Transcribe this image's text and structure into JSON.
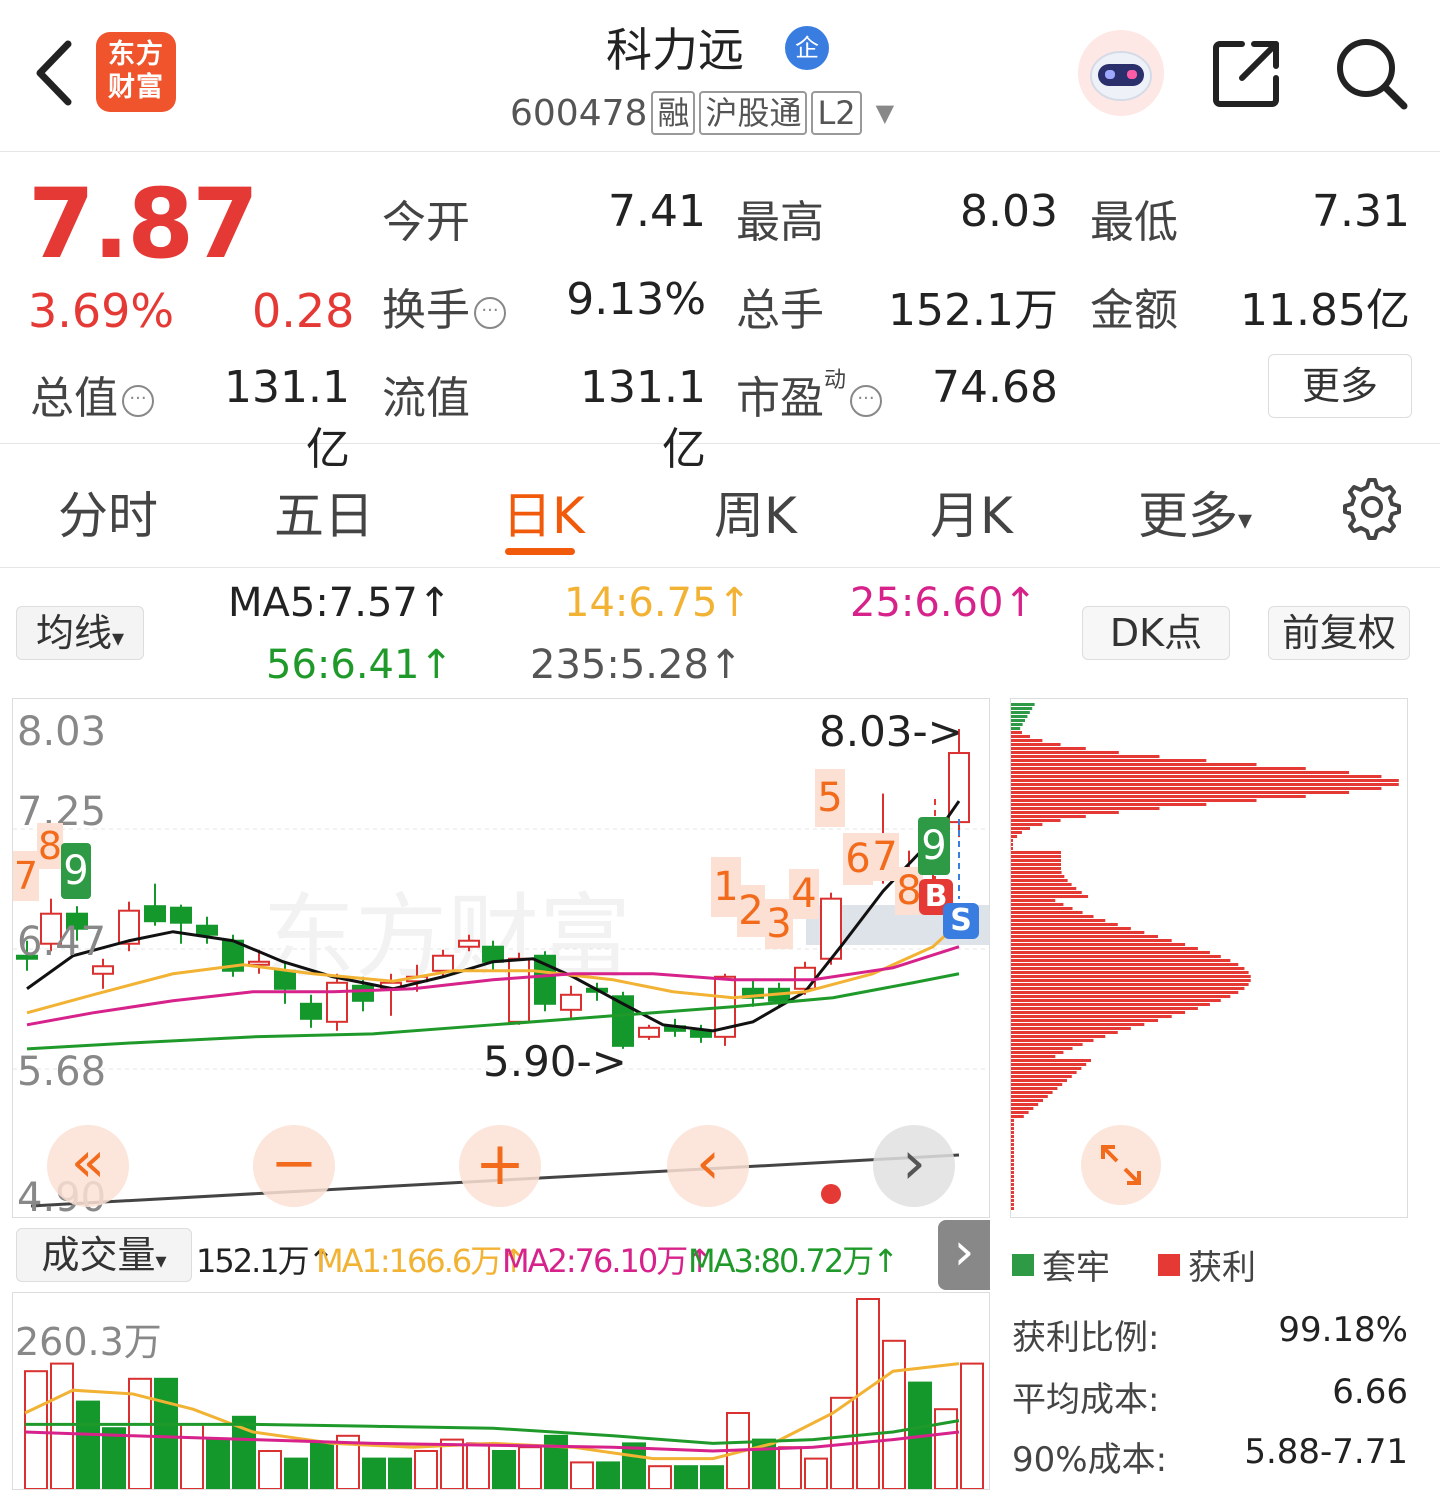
{
  "header": {
    "logo_text_line1": "东方",
    "logo_text_line2": "财富",
    "stock_name": "科力远",
    "ent_badge": "企",
    "code": "600478",
    "tags": [
      "融",
      "沪股通",
      "L2"
    ],
    "dropdown_glyph": "▼"
  },
  "quote": {
    "price": "7.87",
    "change_pct": "3.69%",
    "change": "0.28",
    "open_label": "今开",
    "open": "7.41",
    "high_label": "最高",
    "high": "8.03",
    "low_label": "最低",
    "low": "7.31",
    "turnover_label": "换手",
    "turnover": "9.13%",
    "volume_label": "总手",
    "volume": "152.1万",
    "amount_label": "金额",
    "amount": "11.85亿",
    "total_mv_label": "总值",
    "total_mv": "131.1亿",
    "float_mv_label": "流值",
    "float_mv": "131.1亿",
    "pe_label": "市盈",
    "pe_sup": "动",
    "pe": "74.68",
    "more_label": "更多",
    "info_glyph": "···"
  },
  "tabs": [
    {
      "label": "分时"
    },
    {
      "label": "五日"
    },
    {
      "label": "日K"
    },
    {
      "label": "周K"
    },
    {
      "label": "月K"
    },
    {
      "label": "更多"
    }
  ],
  "tabs_more_arrow": "▾",
  "ma_bar": {
    "selector": "均线",
    "selector_arrow": "▾",
    "ma5": "MA5:7.57↑",
    "ma14": "14:6.75↑",
    "ma25": "25:6.60↑",
    "ma56": "56:6.41↑",
    "ma235": "235:5.28↑",
    "dk_label": "DK点",
    "adjust_label": "前复权"
  },
  "kchart": {
    "y_labels": [
      "8.03",
      "7.25",
      "6.47",
      "5.68",
      "4.90"
    ],
    "high_marker": "8.03->",
    "low_marker": "5.90->",
    "watermark": "东方财富",
    "signals": [
      "7",
      "8",
      "9",
      "1",
      "2",
      "3",
      "4",
      "5",
      "6",
      "7",
      "8",
      "9",
      "B",
      "S"
    ],
    "colors": {
      "up": "#d93030",
      "down": "#14982c",
      "ma5": "#111111",
      "ma14": "#f2b233",
      "ma25": "#d6228a",
      "ma56": "#1f9a2a"
    }
  },
  "controls": {
    "rewind": "«",
    "zoom_out": "−",
    "zoom_in": "+",
    "prev": "‹",
    "next": "›"
  },
  "volume": {
    "selector": "成交量",
    "selector_arrow": "▾",
    "vol": "152.1万↑",
    "ma1": "MA1:166.6万↑",
    "ma2": "MA2:76.10万↑",
    "ma3": "MA3:80.72万↑",
    "expand_glyph": "›",
    "y_label": "260.3万"
  },
  "chips": {
    "legend_trapped": "套牢",
    "legend_profit": "获利",
    "profit_ratio_label": "获利比例:",
    "profit_ratio": "99.18%",
    "avg_cost_label": "平均成本:",
    "avg_cost": "6.66",
    "cost90_label": "90%成本:",
    "cost90": "5.88-7.71"
  }
}
